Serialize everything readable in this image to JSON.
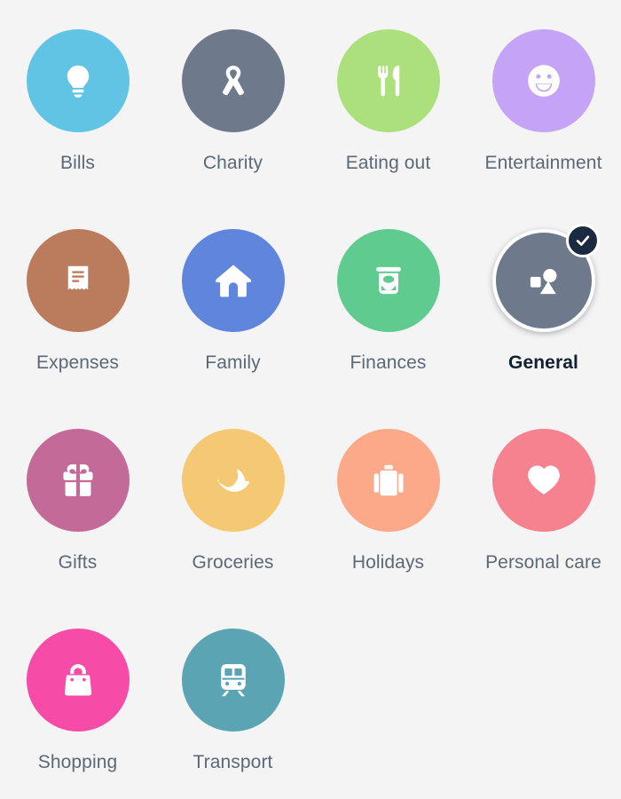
{
  "screen": {
    "name": "category-picker",
    "background_color": "#f5f4f4",
    "label_color": "#5b6876",
    "selected_label_color": "#12202f",
    "selected_badge_color": "#1b2a41",
    "columns": 4,
    "rows": 4
  },
  "categories": [
    {
      "label": "Bills",
      "icon": "lightbulb-icon",
      "color": "#62c4e4",
      "selected": false
    },
    {
      "label": "Charity",
      "icon": "awareness-ribbon-icon",
      "color": "#6e7a8c",
      "selected": false
    },
    {
      "label": "Eating out",
      "icon": "fork-knife-icon",
      "color": "#ace07c",
      "selected": false
    },
    {
      "label": "Entertainment",
      "icon": "smiley-face-icon",
      "color": "#c5a4f7",
      "selected": false
    },
    {
      "label": "Expenses",
      "icon": "receipt-icon",
      "color": "#bb7c5e",
      "selected": false
    },
    {
      "label": "Family",
      "icon": "house-icon",
      "color": "#5f85dd",
      "selected": false
    },
    {
      "label": "Finances",
      "icon": "money-jar-icon",
      "color": "#5fcb8f",
      "selected": false
    },
    {
      "label": "General",
      "icon": "shapes-icon",
      "color": "#6e7a8c",
      "selected": true
    },
    {
      "label": "Gifts",
      "icon": "gift-box-icon",
      "color": "#c46a99",
      "selected": false
    },
    {
      "label": "Groceries",
      "icon": "banana-icon",
      "color": "#f5c873",
      "selected": false
    },
    {
      "label": "Holidays",
      "icon": "suitcase-icon",
      "color": "#fba989",
      "selected": false
    },
    {
      "label": "Personal care",
      "icon": "heart-icon",
      "color": "#f5828e",
      "selected": false
    },
    {
      "label": "Shopping",
      "icon": "shopping-bag-icon",
      "color": "#f74ba8",
      "selected": false
    },
    {
      "label": "Transport",
      "icon": "train-icon",
      "color": "#5ba4b4",
      "selected": false
    }
  ],
  "selected_category": "General",
  "check_badge_icon": "check-icon"
}
